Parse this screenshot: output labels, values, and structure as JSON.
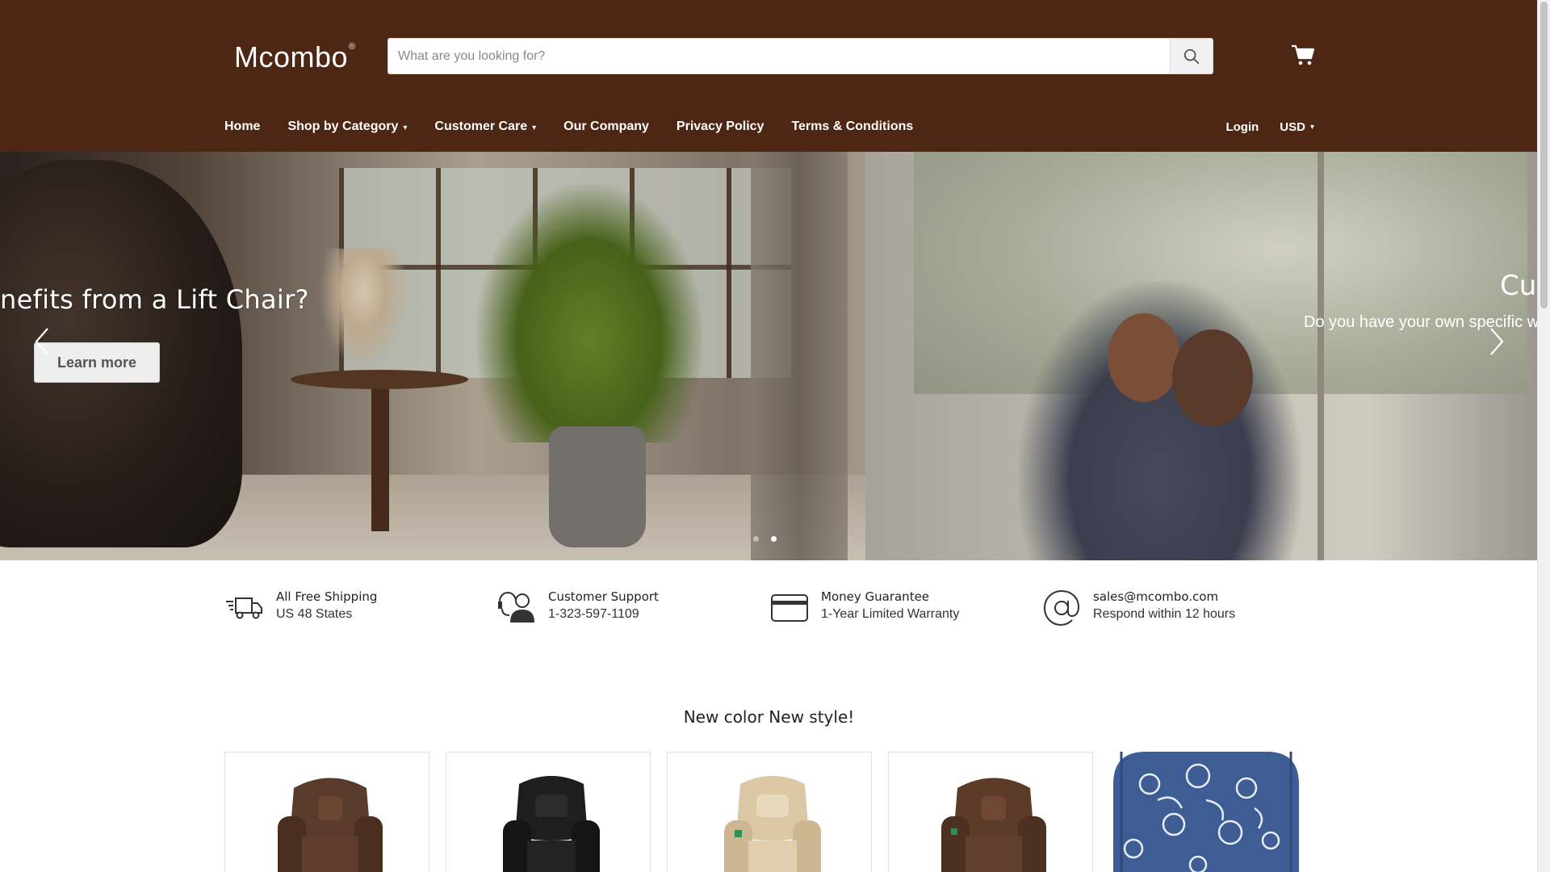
{
  "header": {
    "logo": "Mcombo",
    "logo_mark": "®",
    "search": {
      "placeholder": "What are you looking for?",
      "icon": "search-icon"
    },
    "cart": {
      "icon": "cart-icon"
    },
    "nav": [
      {
        "label": "Home",
        "dropdown": false
      },
      {
        "label": "Shop by Category",
        "dropdown": true
      },
      {
        "label": "Customer Care",
        "dropdown": true
      },
      {
        "label": "Our Company",
        "dropdown": false
      },
      {
        "label": "Privacy Policy",
        "dropdown": false
      },
      {
        "label": "Terms & Conditions",
        "dropdown": false
      }
    ],
    "login": "Login",
    "currency": "USD",
    "colors": {
      "header_bg": "#4d2713",
      "text": "#ffffff"
    }
  },
  "hero": {
    "slides": [
      {
        "title": "nefits from a Lift Chair?",
        "button": "Learn more"
      },
      {
        "title": "Cus",
        "subtitle": "Do you have your own specific w"
      }
    ],
    "active_dot": 2,
    "dot_count": 2
  },
  "features": [
    {
      "icon": "truck-icon",
      "title": "All Free Shipping",
      "subtitle": "US 48 States"
    },
    {
      "icon": "support-person-icon",
      "title": "Customer Support",
      "subtitle": "1-323-597-1109"
    },
    {
      "icon": "credit-card-icon",
      "title": "Money Guarantee",
      "subtitle": "1-Year Limited Warranty"
    },
    {
      "icon": "at-sign-icon",
      "title": "sales@mcombo.com",
      "subtitle": "Respond within 12 hours"
    }
  ],
  "section": {
    "title": "New color New style!"
  },
  "products": [
    {
      "name": "brown-fabric-recliner",
      "color": "#5a3a2a"
    },
    {
      "name": "black-leather-recliner",
      "color": "#1e1e1e"
    },
    {
      "name": "beige-leather-recliner",
      "color": "#d8c3a0"
    },
    {
      "name": "brown-fabric-recliner-2",
      "color": "#5c3b29"
    },
    {
      "name": "blue-floral-recliner",
      "color": "#3e5d94"
    }
  ]
}
